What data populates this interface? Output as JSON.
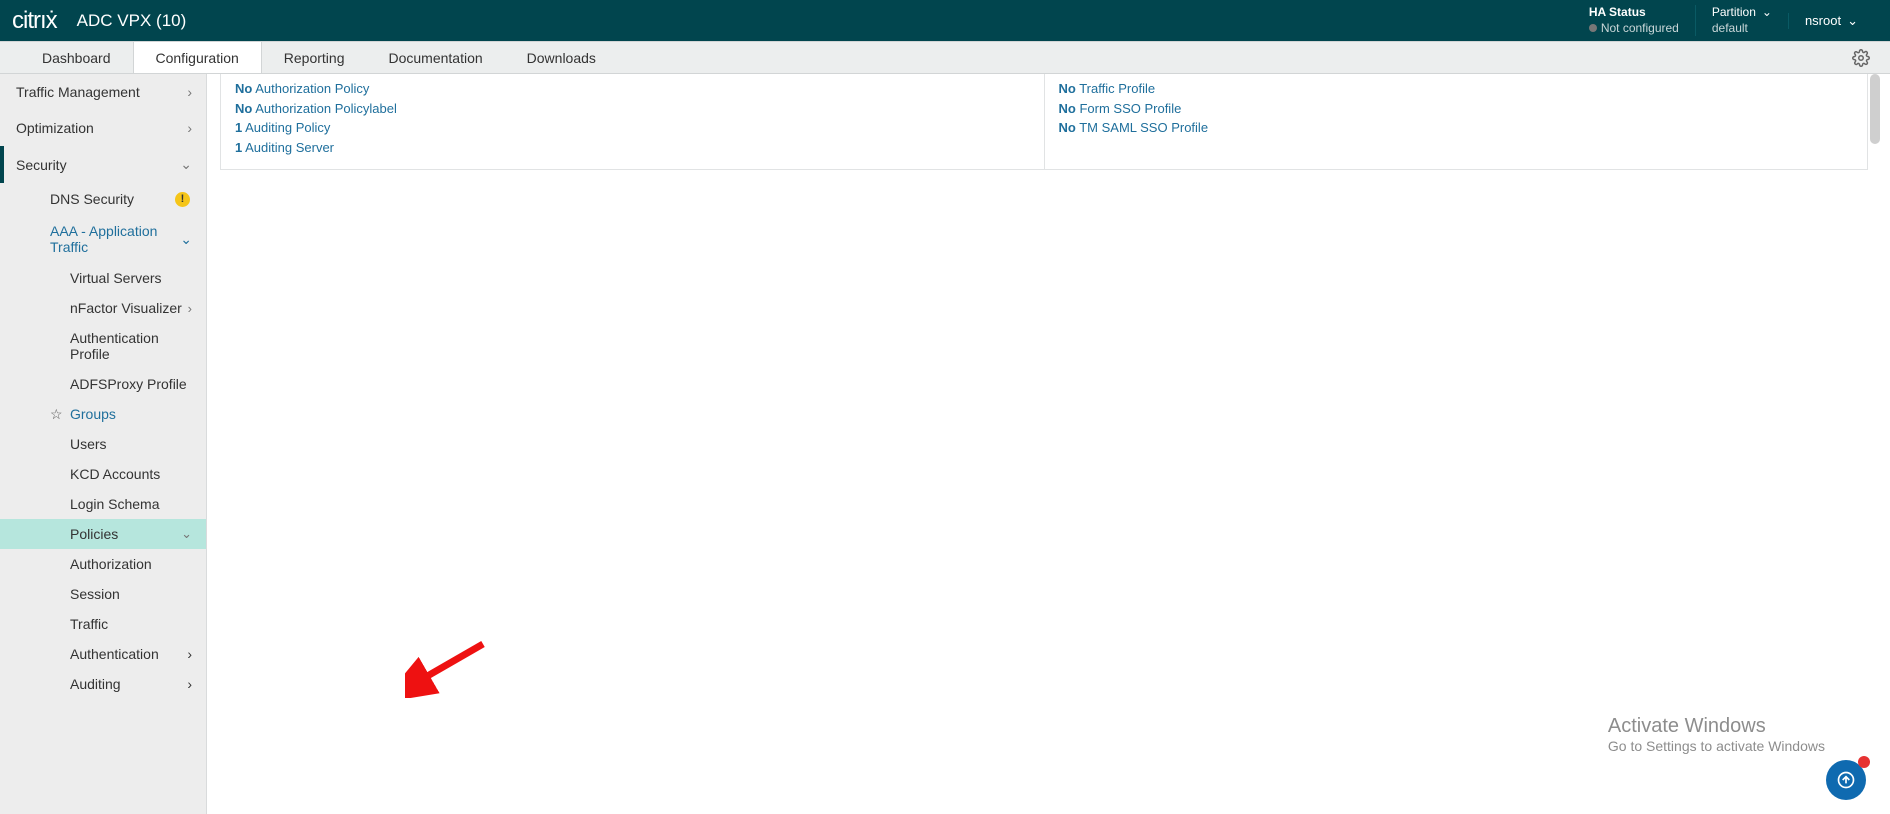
{
  "header": {
    "brand": "citrıẋ",
    "product": "ADC VPX (10)",
    "ha_label": "HA Status",
    "ha_value": "Not configured",
    "partition_label": "Partition",
    "partition_value": "default",
    "user": "nsroot"
  },
  "tabs": [
    "Dashboard",
    "Configuration",
    "Reporting",
    "Documentation",
    "Downloads"
  ],
  "active_tab": 1,
  "sidebar": {
    "traffic_mgmt": "Traffic Management",
    "optimization": "Optimization",
    "security": "Security",
    "dns_security": "DNS Security",
    "aaa": "AAA - Application Traffic",
    "virtual_servers": "Virtual Servers",
    "nfactor": "nFactor Visualizer",
    "auth_profile": "Authentication Profile",
    "adfs": "ADFSProxy Profile",
    "groups": "Groups",
    "users": "Users",
    "kcd": "KCD Accounts",
    "login_schema": "Login Schema",
    "policies": "Policies",
    "authorization": "Authorization",
    "session": "Session",
    "traffic": "Traffic",
    "authentication": "Authentication",
    "auditing": "Auditing"
  },
  "content": {
    "left": [
      {
        "pre": "No",
        "text": " Authorization Policy"
      },
      {
        "pre": "No",
        "text": " Authorization Policylabel"
      },
      {
        "pre": "1",
        "text": " Auditing Policy"
      },
      {
        "pre": "1",
        "text": " Auditing Server"
      }
    ],
    "right": [
      {
        "pre": "No",
        "text": " Traffic Profile"
      },
      {
        "pre": "No",
        "text": " Form SSO Profile"
      },
      {
        "pre": "No",
        "text": " TM SAML SSO Profile"
      }
    ]
  },
  "watermark": {
    "line1": "Activate Windows",
    "line2": "Go to Settings to activate Windows"
  }
}
